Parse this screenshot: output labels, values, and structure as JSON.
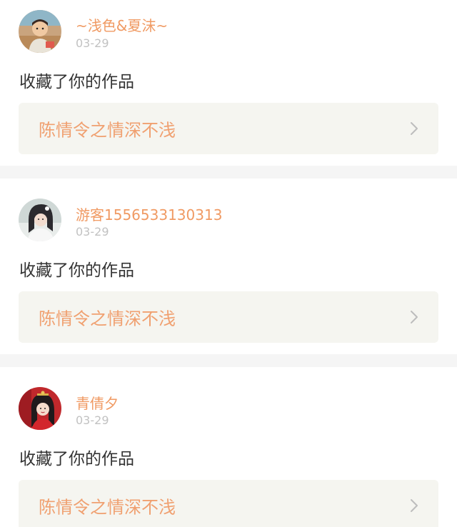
{
  "notifications": [
    {
      "username": "~浅色&夏沫~",
      "date": "03-29",
      "action": "收藏了你的作品",
      "work_title": "陈情令之情深不浅",
      "avatar_icon": "avatar-child-photo-icon"
    },
    {
      "username": "游客1556533130313",
      "date": "03-29",
      "action": "收藏了你的作品",
      "work_title": "陈情令之情深不浅",
      "avatar_icon": "avatar-girl-white-photo-icon"
    },
    {
      "username": "青倩夕",
      "date": "03-29",
      "action": "收藏了你的作品",
      "work_title": "陈情令之情深不浅",
      "avatar_icon": "avatar-girl-red-photo-icon"
    }
  ],
  "colors": {
    "username": "#f09a63",
    "work_title": "#f0a070",
    "date": "#c2c2c2",
    "action_text": "#333333",
    "link_bg": "#f5f5f0",
    "separator": "#f5f5f5"
  }
}
